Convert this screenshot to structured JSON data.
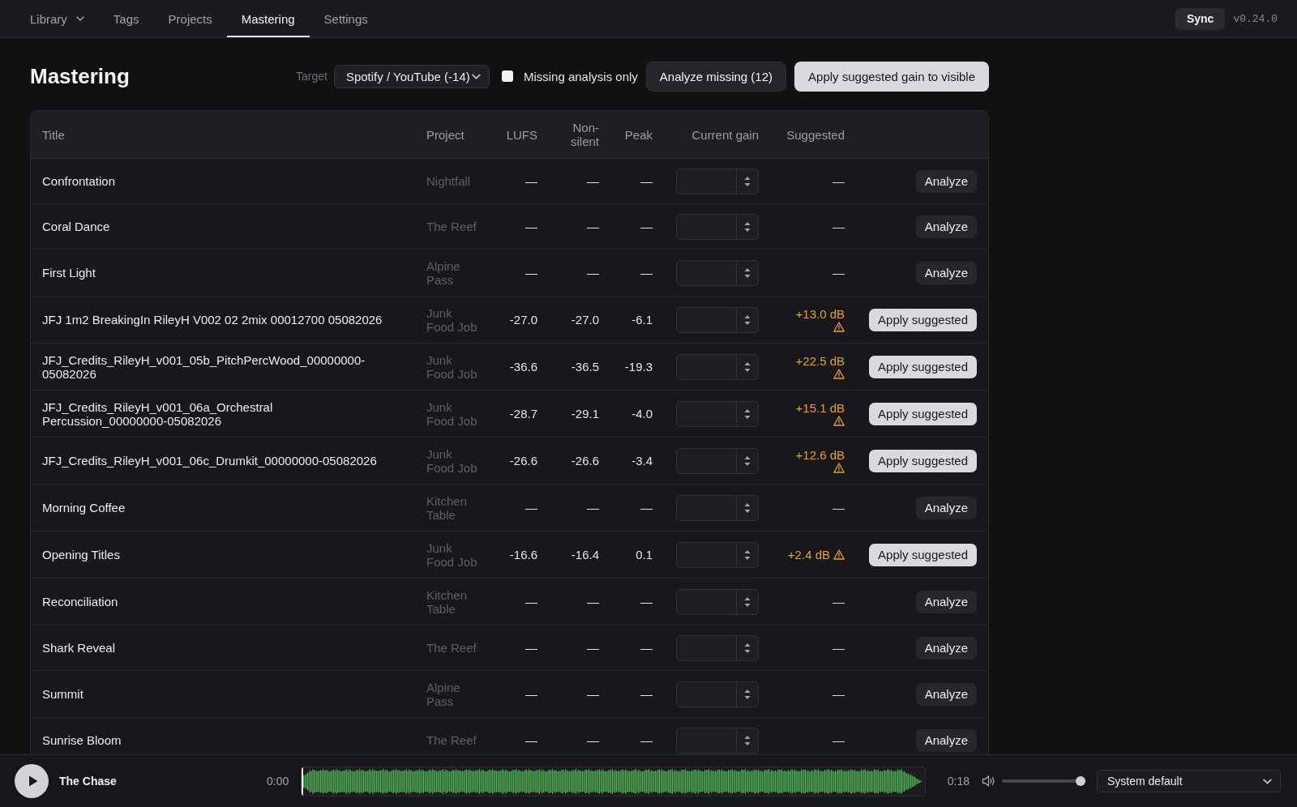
{
  "nav": {
    "tabs": [
      {
        "label": "Library",
        "selected": false,
        "dropdown": true
      },
      {
        "label": "Tags",
        "selected": false,
        "dropdown": false
      },
      {
        "label": "Projects",
        "selected": false,
        "dropdown": false
      },
      {
        "label": "Mastering",
        "selected": true,
        "dropdown": false
      },
      {
        "label": "Settings",
        "selected": false,
        "dropdown": false
      }
    ],
    "sync": "Sync",
    "version": "v0.24.0"
  },
  "header": {
    "title": "Mastering",
    "target": {
      "label": "Target",
      "value": "Spotify / YouTube (-14)"
    },
    "missing_only": {
      "label": "Missing analysis only",
      "checked": false
    },
    "buttons": [
      {
        "label": "Analyze missing (12)",
        "kind": "secondary"
      },
      {
        "label": "Apply suggested gain to visible",
        "kind": "primary"
      }
    ]
  },
  "table": {
    "columns": [
      "Title",
      "Project",
      "LUFS",
      "Non-silent",
      "Peak",
      "Current gain",
      "Suggested"
    ],
    "rows": [
      {
        "title": "Confrontation",
        "project": "Nightfall",
        "lufs": "—",
        "non_silent": "—",
        "peak": "—",
        "suggested": {
          "text": "—",
          "warning": false
        },
        "action": {
          "kind": "analyze",
          "label": "Analyze"
        }
      },
      {
        "title": "Coral Dance",
        "project": "The Reef",
        "lufs": "—",
        "non_silent": "—",
        "peak": "—",
        "suggested": {
          "text": "—",
          "warning": false
        },
        "action": {
          "kind": "analyze",
          "label": "Analyze"
        }
      },
      {
        "title": "First Light",
        "project": "Alpine Pass",
        "lufs": "—",
        "non_silent": "—",
        "peak": "—",
        "suggested": {
          "text": "—",
          "warning": false
        },
        "action": {
          "kind": "analyze",
          "label": "Analyze"
        }
      },
      {
        "title": "JFJ 1m2 BreakingIn RileyH V002 02 2mix 00012700 05082026",
        "project": "Junk Food Job",
        "lufs": "-27.0",
        "non_silent": "-27.0",
        "peak": "-6.1",
        "suggested": {
          "text": "+13.0 dB",
          "warning": true
        },
        "action": {
          "kind": "apply",
          "label": "Apply suggested"
        }
      },
      {
        "title": "JFJ_Credits_RileyH_v001_05b_PitchPercWood_00000000-05082026",
        "project": "Junk Food Job",
        "lufs": "-36.6",
        "non_silent": "-36.5",
        "peak": "-19.3",
        "suggested": {
          "text": "+22.5 dB",
          "warning": true
        },
        "action": {
          "kind": "apply",
          "label": "Apply suggested"
        }
      },
      {
        "title": "JFJ_Credits_RileyH_v001_06a_Orchestral Percussion_00000000-05082026",
        "project": "Junk Food Job",
        "lufs": "-28.7",
        "non_silent": "-29.1",
        "peak": "-4.0",
        "suggested": {
          "text": "+15.1 dB",
          "warning": true
        },
        "action": {
          "kind": "apply",
          "label": "Apply suggested"
        }
      },
      {
        "title": "JFJ_Credits_RileyH_v001_06c_Drumkit_00000000-05082026",
        "project": "Junk Food Job",
        "lufs": "-26.6",
        "non_silent": "-26.6",
        "peak": "-3.4",
        "suggested": {
          "text": "+12.6 dB",
          "warning": true
        },
        "action": {
          "kind": "apply",
          "label": "Apply suggested"
        }
      },
      {
        "title": "Morning Coffee",
        "project": "Kitchen Table",
        "lufs": "—",
        "non_silent": "—",
        "peak": "—",
        "suggested": {
          "text": "—",
          "warning": false
        },
        "action": {
          "kind": "analyze",
          "label": "Analyze"
        }
      },
      {
        "title": "Opening Titles",
        "project": "Junk Food Job",
        "lufs": "-16.6",
        "non_silent": "-16.4",
        "peak": "0.1",
        "suggested": {
          "text": "+2.4 dB",
          "warning": true
        },
        "action": {
          "kind": "apply",
          "label": "Apply suggested"
        }
      },
      {
        "title": "Reconciliation",
        "project": "Kitchen Table",
        "lufs": "—",
        "non_silent": "—",
        "peak": "—",
        "suggested": {
          "text": "—",
          "warning": false
        },
        "action": {
          "kind": "analyze",
          "label": "Analyze"
        }
      },
      {
        "title": "Shark Reveal",
        "project": "The Reef",
        "lufs": "—",
        "non_silent": "—",
        "peak": "—",
        "suggested": {
          "text": "—",
          "warning": false
        },
        "action": {
          "kind": "analyze",
          "label": "Analyze"
        }
      },
      {
        "title": "Summit",
        "project": "Alpine Pass",
        "lufs": "—",
        "non_silent": "—",
        "peak": "—",
        "suggested": {
          "text": "—",
          "warning": false
        },
        "action": {
          "kind": "analyze",
          "label": "Analyze"
        }
      },
      {
        "title": "Sunrise Bloom",
        "project": "The Reef",
        "lufs": "—",
        "non_silent": "—",
        "peak": "—",
        "suggested": {
          "text": "—",
          "warning": false
        },
        "action": {
          "kind": "analyze",
          "label": "Analyze"
        }
      }
    ]
  },
  "player": {
    "title": "The Chase",
    "elapsed": "0:00",
    "duration": "0:18",
    "level": 0,
    "volume": {
      "level": 1
    },
    "output": "System default"
  }
}
